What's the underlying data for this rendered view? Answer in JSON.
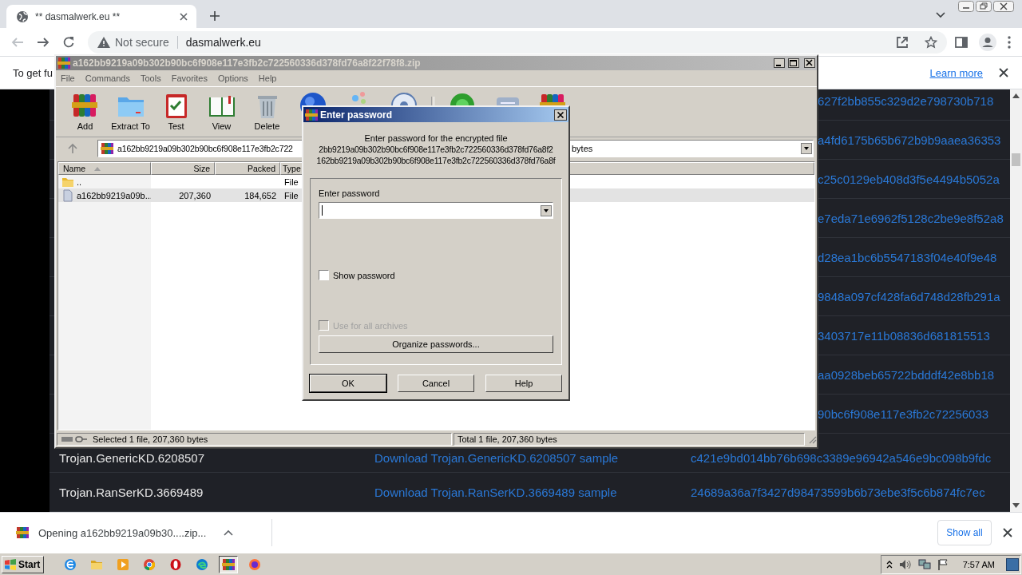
{
  "browser": {
    "tab": {
      "title": "** dasmalwerk.eu **"
    },
    "address": {
      "security": "Not secure",
      "url": "dasmalwerk.eu"
    }
  },
  "banner": {
    "text": "To get fu",
    "link": "Learn more"
  },
  "table": {
    "rows": [
      {
        "hash": "627f2bb855c329d2e798730b718"
      },
      {
        "hash": "a4fd6175b65b672b9b9aaea36353"
      },
      {
        "hash": "c25c0129eb408d3f5e4494b5052a"
      },
      {
        "hash": "e7eda71e6962f5128c2be9e8f52a8"
      },
      {
        "hash": "d28ea1bc6b5547183f04e40f9e48"
      },
      {
        "hash": "9848a097cf428fa6d748d28fb291a"
      },
      {
        "hash": "3403717e11b08836d681815513"
      },
      {
        "hash": "aa0928beb65722bdddf42e8bb18"
      },
      {
        "hash": "90bc6f908e117e3fb2c72256033"
      },
      {
        "name": "Trojan.GenericKD.6208507",
        "link": "Download Trojan.GenericKD.6208507 sample",
        "hash": "c421e9bd014bb76b698c3389e96942a546e9bc098b9fdc"
      },
      {
        "name": "Trojan.RanSerKD.3669489",
        "link": "Download Trojan.RanSerKD.3669489 sample",
        "hash": "24689a36a7f3427d98473599b6b73ebe3f5c6b874fc7ec"
      }
    ]
  },
  "winrar": {
    "title": "a162bb9219a09b302b90bc6f908e117e3fb2c722560336d378fd76a8f22f78f8.zip",
    "menu": [
      "File",
      "Commands",
      "Tools",
      "Favorites",
      "Options",
      "Help"
    ],
    "toolbar": [
      "Add",
      "Extract To",
      "Test",
      "View",
      "Delete"
    ],
    "path": "a162bb9219a09b302b90bc6f908e117e3fb2c722",
    "path_end": "bytes",
    "columns": [
      {
        "label": "Name",
        "sorted": true
      },
      {
        "label": "Size",
        "sorted": false
      },
      {
        "label": "Packed",
        "sorted": false
      },
      {
        "label": "Type",
        "sorted": false
      }
    ],
    "files": [
      {
        "kind": "folder",
        "name": "..",
        "type": "File",
        "selected": false
      },
      {
        "kind": "file",
        "name": "a162bb9219a09b...",
        "size": "207,360",
        "packed": "184,652",
        "type": "File",
        "selected": true
      }
    ],
    "status": [
      "Selected 1 file, 207,360 bytes",
      "Total 1 file, 207,360 bytes"
    ]
  },
  "dialog": {
    "title": "Enter password",
    "prompt": "Enter password for the encrypted file",
    "filename_lines": [
      "2bb9219a09b302b90bc6f908e117e3fb2c722560336d378fd76a8f2",
      "162bb9219a09b302b90bc6f908e117e3fb2c722560336d378fd76a8f"
    ],
    "group_label": "Enter password",
    "options": [
      {
        "label": "Show password",
        "checked": false,
        "disabled": false
      },
      {
        "label": "Use for all archives",
        "checked": false,
        "disabled": true
      }
    ],
    "organize": "Organize passwords...",
    "buttons": [
      {
        "label": "OK",
        "default": true
      },
      {
        "label": "Cancel",
        "default": false
      },
      {
        "label": "Help",
        "default": false
      }
    ]
  },
  "downloads": {
    "item": "Opening a162bb9219a09b30....zip...",
    "show_all": "Show all"
  },
  "taskbar": {
    "start": "Start",
    "clock": "7:57 AM",
    "apps": [
      {
        "selected": false
      },
      {
        "selected": false
      },
      {
        "selected": false
      },
      {
        "selected": false
      },
      {
        "selected": false
      },
      {
        "selected": false
      },
      {
        "selected": true
      },
      {
        "selected": false
      }
    ]
  }
}
